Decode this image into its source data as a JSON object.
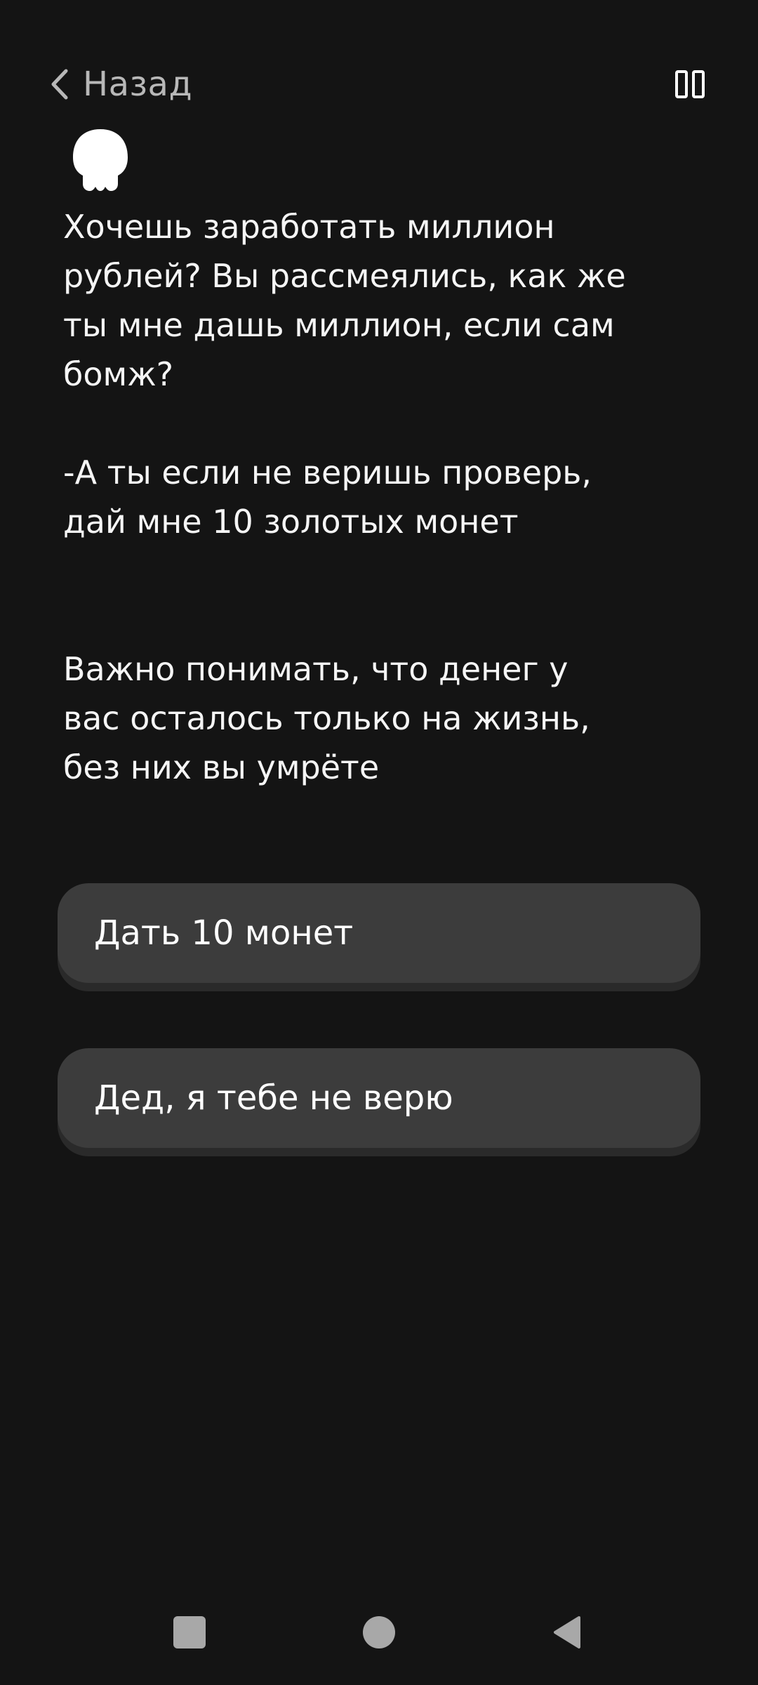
{
  "header": {
    "back_label": "Назад",
    "back_icon": "chevron-left-icon",
    "pause_icon": "pause-icon"
  },
  "character": {
    "avatar_icon": "skull-icon"
  },
  "story": {
    "paragraph_1": "Хочешь заработать миллион\nрублей? Вы рассмеялись, как же\nты мне дашь миллион, если сам\nбомж?",
    "paragraph_2": "-А ты если не веришь проверь,\nдай мне 10 золотых монет",
    "paragraph_3": "Важно понимать, что денег у\nвас осталось только на жизнь,\nбез них вы умрёте"
  },
  "choices": [
    {
      "label": "Дать 10 монет"
    },
    {
      "label": "Дед, я тебе не верю"
    }
  ],
  "system_nav": {
    "recents_icon": "square-icon",
    "home_icon": "circle-icon",
    "back_icon": "triangle-back-icon"
  },
  "colors": {
    "background": "#141414",
    "button": "#3c3c3c",
    "text": "#f5f5f5",
    "muted": "#b8b8b8"
  }
}
